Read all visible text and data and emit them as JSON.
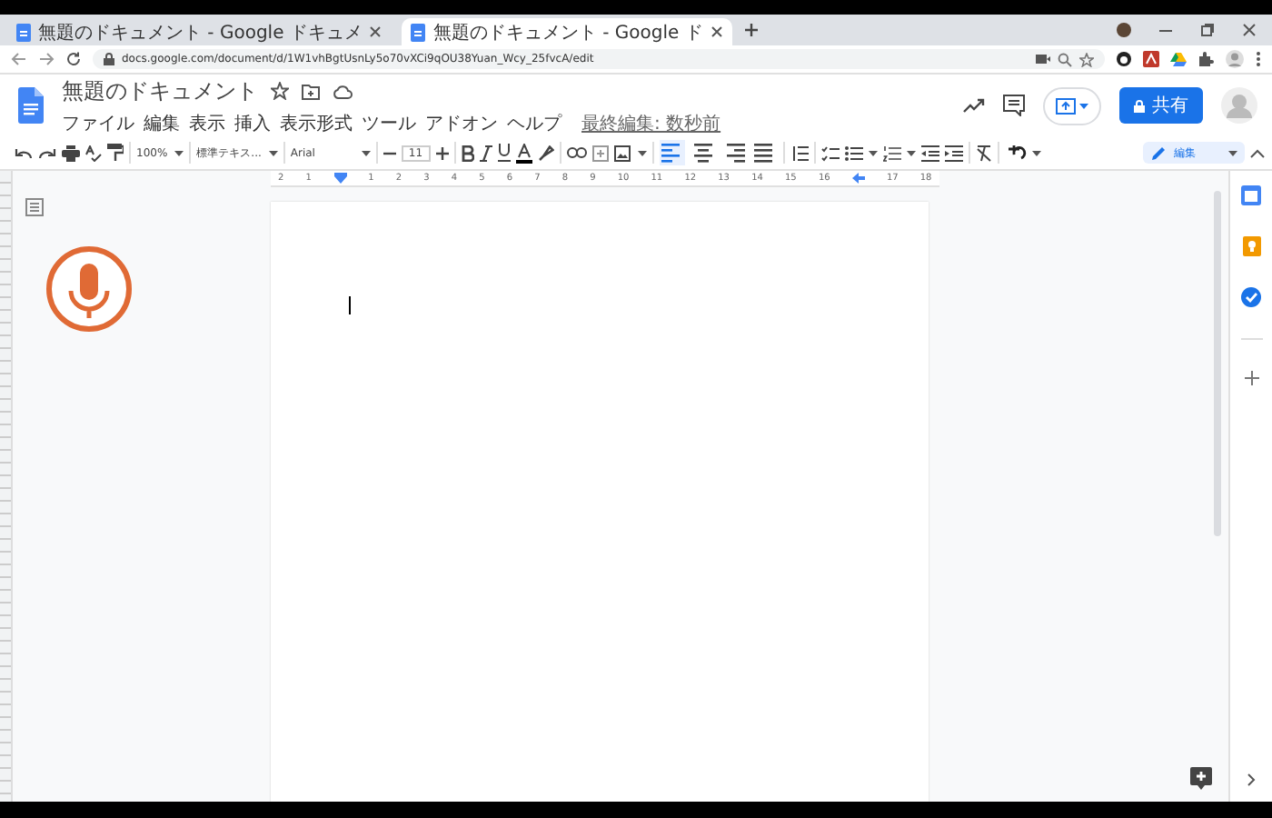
{
  "browser": {
    "tabs": [
      {
        "title": "無題のドキュメント - Google ドキュメ",
        "selected": false
      },
      {
        "title": "無題のドキュメント - Google ド",
        "selected": true
      }
    ],
    "url": "docs.google.com/document/d/1W1vhBgtUsnLy5o70vXCi9qOU38Yuan_Wcy_25fvcA/edit"
  },
  "doc": {
    "title": "無題のドキュメント",
    "menu": [
      "ファイル",
      "編集",
      "表示",
      "挿入",
      "表示形式",
      "ツール",
      "アドオン",
      "ヘルプ"
    ],
    "last_edit": "最終編集: 数秒前",
    "share_button": "共有"
  },
  "toolbar": {
    "zoom": "100%",
    "style": "標準テキス...",
    "font": "Arial",
    "font_size": "11",
    "mode": "編集",
    "alignment": [
      {
        "kind": "left",
        "selected": true
      },
      {
        "kind": "center",
        "selected": false
      },
      {
        "kind": "right",
        "selected": false
      },
      {
        "kind": "justify",
        "selected": false
      }
    ]
  },
  "ruler": {
    "labels": [
      "2",
      "1",
      "1",
      "2",
      "3",
      "4",
      "5",
      "6",
      "7",
      "8",
      "9",
      "10",
      "11",
      "12",
      "13",
      "14",
      "15",
      "16",
      "17",
      "18"
    ]
  }
}
